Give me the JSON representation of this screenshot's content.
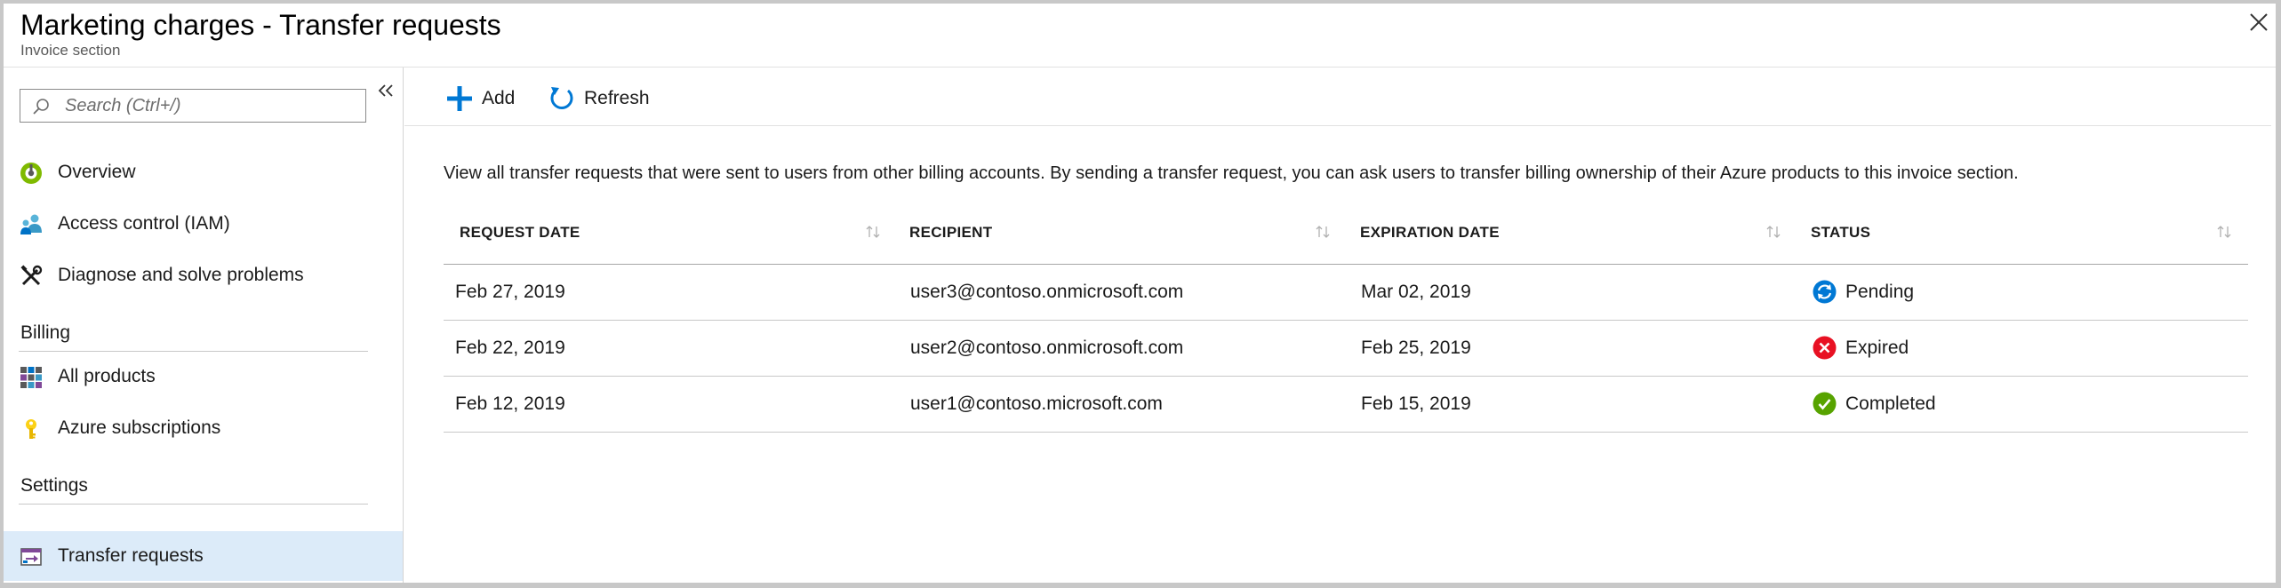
{
  "header": {
    "title": "Marketing charges - Transfer requests",
    "subtitle": "Invoice section"
  },
  "search": {
    "placeholder": "Search (Ctrl+/)",
    "value": ""
  },
  "nav": {
    "items_top": [
      {
        "label": "Overview",
        "icon": "overview-icon"
      },
      {
        "label": "Access control (IAM)",
        "icon": "people-icon"
      },
      {
        "label": "Diagnose and solve problems",
        "icon": "wrench-icon"
      }
    ],
    "billing": {
      "heading": "Billing",
      "items": [
        {
          "label": "All products",
          "icon": "grid-icon"
        },
        {
          "label": "Azure subscriptions",
          "icon": "key-icon"
        }
      ]
    },
    "settings": {
      "heading": "Settings",
      "items": [
        {
          "label": "Transfer requests",
          "icon": "transfer-icon",
          "selected": true
        }
      ]
    }
  },
  "toolbar": {
    "add_label": "Add",
    "refresh_label": "Refresh"
  },
  "description": "View all transfer requests that were sent to users from other billing accounts. By sending a transfer request, you can ask users to transfer billing ownership of their Azure products to this invoice section.",
  "table": {
    "columns": [
      "REQUEST DATE",
      "RECIPIENT",
      "EXPIRATION DATE",
      "STATUS"
    ],
    "rows": [
      {
        "request_date": "Feb 27, 2019",
        "recipient": "user3@contoso.onmicrosoft.com",
        "expiration_date": "Mar 02, 2019",
        "status": "Pending",
        "status_icon": "pending-icon"
      },
      {
        "request_date": "Feb 22, 2019",
        "recipient": "user2@contoso.onmicrosoft.com",
        "expiration_date": "Feb 25, 2019",
        "status": "Expired",
        "status_icon": "expired-icon"
      },
      {
        "request_date": "Feb 12, 2019",
        "recipient": "user1@contoso.microsoft.com",
        "expiration_date": "Feb 15, 2019",
        "status": "Completed",
        "status_icon": "completed-icon"
      }
    ]
  },
  "colors": {
    "accent": "#0078d4",
    "selected_bg": "#dcebf9",
    "pending": "#0078d4",
    "expired": "#e81123",
    "completed": "#57a300"
  }
}
